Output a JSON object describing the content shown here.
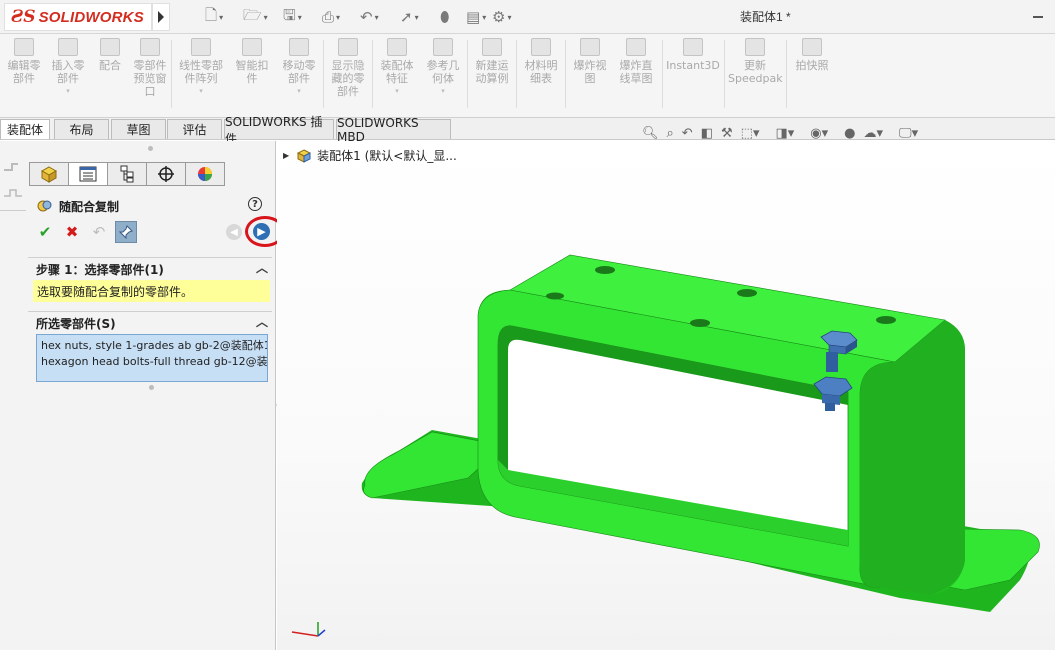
{
  "app": {
    "logo_ds": "ƧS",
    "logo_text": "SOLIDWORKS",
    "doc_title": "装配体1 *"
  },
  "ribbon": {
    "buttons": [
      {
        "label": "编辑零\n部件",
        "icon": "edit-component-icon"
      },
      {
        "label": "插入零\n部件",
        "icon": "insert-component-icon",
        "dropdown": "▾"
      },
      {
        "label": "配合",
        "icon": "mate-icon"
      },
      {
        "label": "零部件\n预览窗\n口",
        "icon": "preview-window-icon"
      },
      {
        "label": "线性零部\n件阵列",
        "icon": "linear-pattern-icon",
        "dropdown": "▾"
      },
      {
        "label": "智能扣\n件",
        "icon": "smart-fastener-icon"
      },
      {
        "label": "移动零\n部件",
        "icon": "move-component-icon",
        "dropdown": "▾"
      },
      {
        "label": "显示隐\n藏的零\n部件",
        "icon": "show-hidden-icon"
      },
      {
        "label": "装配体\n特征",
        "icon": "assembly-feature-icon",
        "dropdown": "▾"
      },
      {
        "label": "参考几\n何体",
        "icon": "reference-geometry-icon",
        "dropdown": "▾"
      },
      {
        "label": "新建运\n动算例",
        "icon": "motion-study-icon"
      },
      {
        "label": "材料明\n细表",
        "icon": "bom-icon"
      },
      {
        "label": "爆炸视\n图",
        "icon": "exploded-view-icon"
      },
      {
        "label": "爆炸直\n线草图",
        "icon": "explode-line-sketch-icon"
      },
      {
        "label": "Instant3D",
        "icon": "instant3d-icon"
      },
      {
        "label": "更新\nSpeedpak",
        "icon": "speedpak-icon"
      },
      {
        "label": "拍快照",
        "icon": "snapshot-icon"
      }
    ]
  },
  "tabs": [
    "装配体",
    "布局",
    "草图",
    "评估",
    "SOLIDWORKS 插件",
    "SOLIDWORKS MBD"
  ],
  "property_manager": {
    "title": "随配合复制",
    "help": "?",
    "step1_title": "步骤 1：选择零部件(1)",
    "step1_message": "选取要随配合复制的零部件。",
    "selected_title": "所选零部件(S)",
    "selected_items": [
      "hex nuts, style 1-grades ab gb-2@装配体1",
      "hexagon head bolts-full thread gb-12@装配"
    ]
  },
  "tree": {
    "root_label": "装配体1  (默认<默认_显..."
  },
  "colors": {
    "part_green": "#33e633",
    "highlight_red": "#d8141c",
    "selection_blue": "#c7dff5",
    "message_yellow": "#ffff99"
  }
}
